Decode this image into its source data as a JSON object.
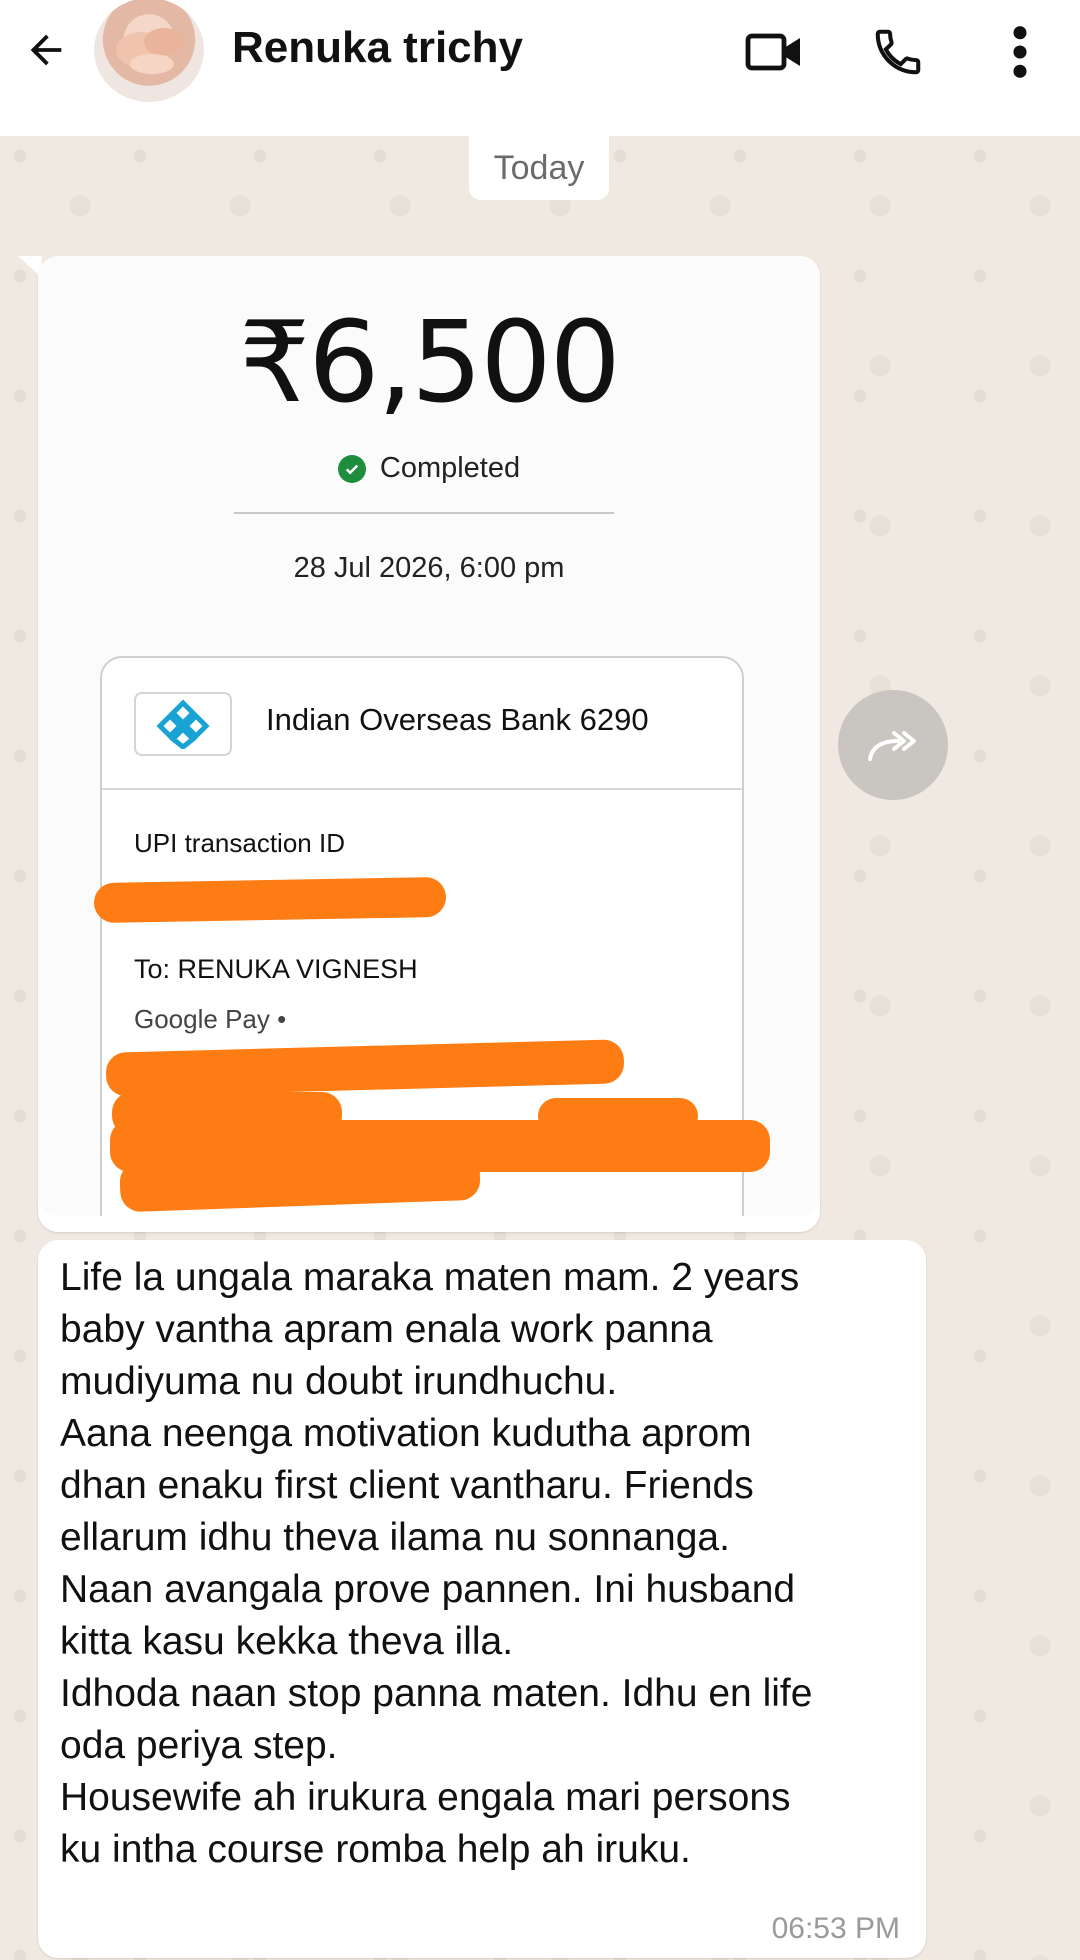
{
  "header": {
    "contact_name": "Renuka trichy",
    "icons": {
      "back": "back-arrow-icon",
      "video": "video-call-icon",
      "call": "phone-icon",
      "menu": "more-vert-icon"
    }
  },
  "chat": {
    "date_chip": "Today",
    "image_message": {
      "amount": "₹6,500",
      "status": "Completed",
      "datetime": "28 Jul 2026, 6:00 pm",
      "bank_name": "Indian Overseas Bank 6290",
      "upi_label": "UPI transaction ID",
      "to_line": "To: RENUKA VIGNESH",
      "gpay_line": "Google Pay •"
    },
    "text_message": {
      "body": "Life la ungala maraka maten mam. 2 years\nbaby vantha apram enala work panna\nmudiyuma nu doubt irundhuchu.\nAana neenga motivation kudutha aprom\ndhan enaku first client vantharu. Friends\nellarum idhu theva ilama nu sonnanga.\nNaan avangala prove pannen. Ini husband\nkitta kasu kekka theva illa.\nIdhoda naan stop panna maten. Idhu en life\noda periya step.\nHousewife ah irukura engala mari persons\nku intha course romba help ah iruku.",
      "time": "06:53 PM"
    }
  },
  "colors": {
    "wallpaper": "#efe9e1",
    "redaction": "#fd7d14",
    "success": "#1e8e3e",
    "bank_logo": "#19a3d4"
  }
}
